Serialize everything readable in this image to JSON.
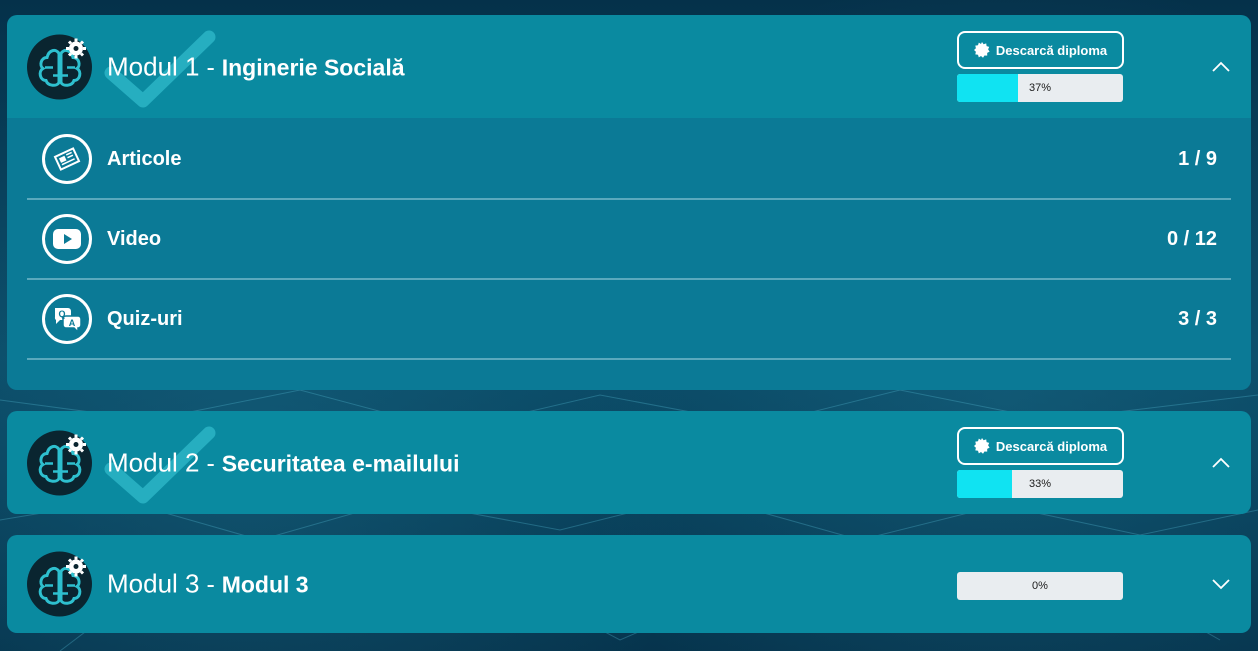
{
  "colors": {
    "header_bg": "#0a8aa0",
    "body_bg": "#0b7a96",
    "progress_fill": "#10e3f2",
    "progress_track": "#e9edf0",
    "page_bg": "#063a54"
  },
  "modules": [
    {
      "number_label": "Modul 1",
      "separator": " - ",
      "name": "Inginerie Socială",
      "diploma_label": "Descarcă diploma",
      "progress_text": "37%",
      "progress": 0.37,
      "completed": true,
      "expanded": true,
      "items": [
        {
          "label": "Articole",
          "count": "1 / 9",
          "icon": "newspaper-icon"
        },
        {
          "label": "Video",
          "count": "0 / 12",
          "icon": "video-play-icon"
        },
        {
          "label": "Quiz-uri",
          "count": "3 / 3",
          "icon": "qa-chat-icon"
        }
      ]
    },
    {
      "number_label": "Modul 2",
      "separator": " - ",
      "name": "Securitatea e-mailului",
      "diploma_label": "Descarcă diploma",
      "progress_text": "33%",
      "progress": 0.33,
      "completed": true,
      "expanded": false
    },
    {
      "number_label": "Modul 3",
      "separator": " - ",
      "name": "Modul 3",
      "progress_text": "0%",
      "progress": 0,
      "completed": false,
      "expanded": false
    }
  ]
}
